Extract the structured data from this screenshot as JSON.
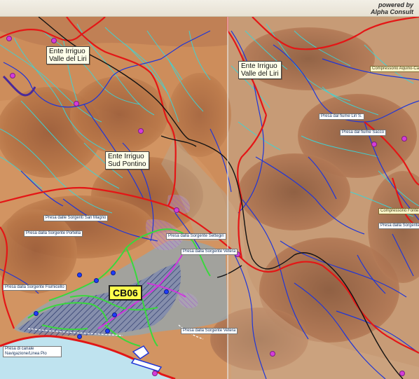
{
  "header": {
    "powered_by": "powered by",
    "brand": "Alpha Consult"
  },
  "map": {
    "callouts": {
      "ente_liri_left_1": "Ente Irriguo",
      "ente_liri_left_2": "Valle del Liri",
      "ente_liri_right_1": "Ente Irriguo",
      "ente_liri_right_2": "Valle del Liri",
      "ente_sud_pontino_1": "Ente Irriguo",
      "ente_sud_pontino_2": "Sud Pontino"
    },
    "cb_label": "CB06",
    "intake_labels": [
      "Presa dalle Sorgenti San Magno",
      "Presa dalla Sorgente Portella",
      "Presa dalla Sorgente Settegiri",
      "Presa dalla Sorgente Vetera",
      "Presa dalla Sorgente Vetera",
      "Presa di canale Navigazione/Linea Pio",
      "Presa dal fiume Liri S.",
      "Presa dal fiume Sacco",
      "Presa dalla Sorgente Fiumicello",
      "Compressorio Aquino-Ca...",
      "Compressorio Fonte...",
      "Presa dalla Sorgente..."
    ],
    "colors": {
      "boundary": "#e41616",
      "rivers": "#1f36d8",
      "canals": "#3dd4d6",
      "roads": "#121212",
      "irrigated_area": "#4f71c4",
      "green_canal": "#39d83d",
      "magenta_line": "#d530e0",
      "sea": "#bfe3ef",
      "pins": "#d53cd9"
    }
  }
}
